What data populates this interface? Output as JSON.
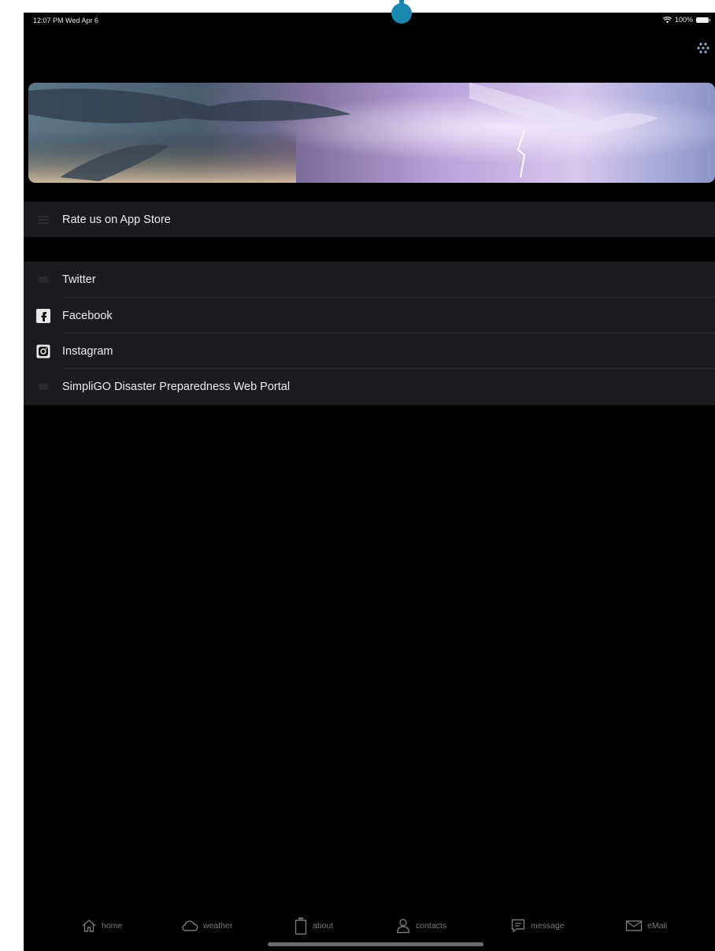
{
  "status": {
    "time": "12:07 PM  Wed Apr 6",
    "battery": "100%",
    "icons": [
      "wifi-icon",
      "battery-icon"
    ]
  },
  "menu": {
    "icon": "dots-grid-icon"
  },
  "banner": {
    "icon": "storm-lightning-image"
  },
  "rate_section": {
    "items": [
      {
        "label": "Rate us on App Store",
        "icon": "list-icon"
      }
    ]
  },
  "links_section": {
    "items": [
      {
        "label": "Twitter",
        "icon": "twitter-icon"
      },
      {
        "label": "Facebook",
        "icon": "facebook-icon"
      },
      {
        "label": "Instagram",
        "icon": "instagram-icon"
      },
      {
        "label": "SimpliGO Disaster Preparedness Web Portal",
        "icon": "web-icon"
      }
    ]
  },
  "tabs": [
    {
      "label": "home",
      "icon": "home-icon"
    },
    {
      "label": "weather",
      "icon": "cloud-icon"
    },
    {
      "label": "about",
      "icon": "bottle-icon"
    },
    {
      "label": "contacts",
      "icon": "person-icon"
    },
    {
      "label": "message",
      "icon": "message-icon"
    },
    {
      "label": "eMail",
      "icon": "envelope-icon"
    }
  ],
  "colors": {
    "background": "#000000",
    "row": "#1c1c1e",
    "camera_dot": "#1a88ad",
    "menu_dots": "#8fb6d6"
  }
}
